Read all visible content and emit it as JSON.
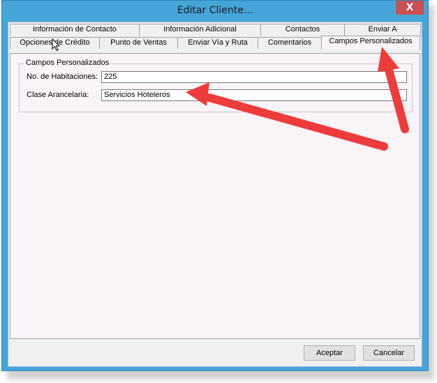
{
  "window": {
    "title": "Editar Cliente...",
    "close_label": "X"
  },
  "tabs_row1": [
    {
      "label": "Información de Contacto"
    },
    {
      "label": "Información Adicional"
    },
    {
      "label": "Contactos"
    },
    {
      "label": "Enviar A"
    }
  ],
  "tabs_row2": [
    {
      "label": "Opciones de Crédito"
    },
    {
      "label": "Punto de Ventas"
    },
    {
      "label": "Enviar Vía y Ruta"
    },
    {
      "label": "Comentarios"
    },
    {
      "label": "Campos Personalizados",
      "active": true
    }
  ],
  "group": {
    "legend": "Campos Personalizados",
    "fields": [
      {
        "label": "No. de Habitaciones:",
        "value": "225"
      },
      {
        "label": "Clase Arancelaria:",
        "value": "Servicios Hoteleros"
      }
    ]
  },
  "buttons": {
    "accept": "Aceptar",
    "cancel": "Cancelar"
  },
  "annotation": {
    "arrow_color": "#ee3b3b",
    "icons": [
      "mouse-pointer-icon",
      "annotation-arrow-icon"
    ]
  }
}
